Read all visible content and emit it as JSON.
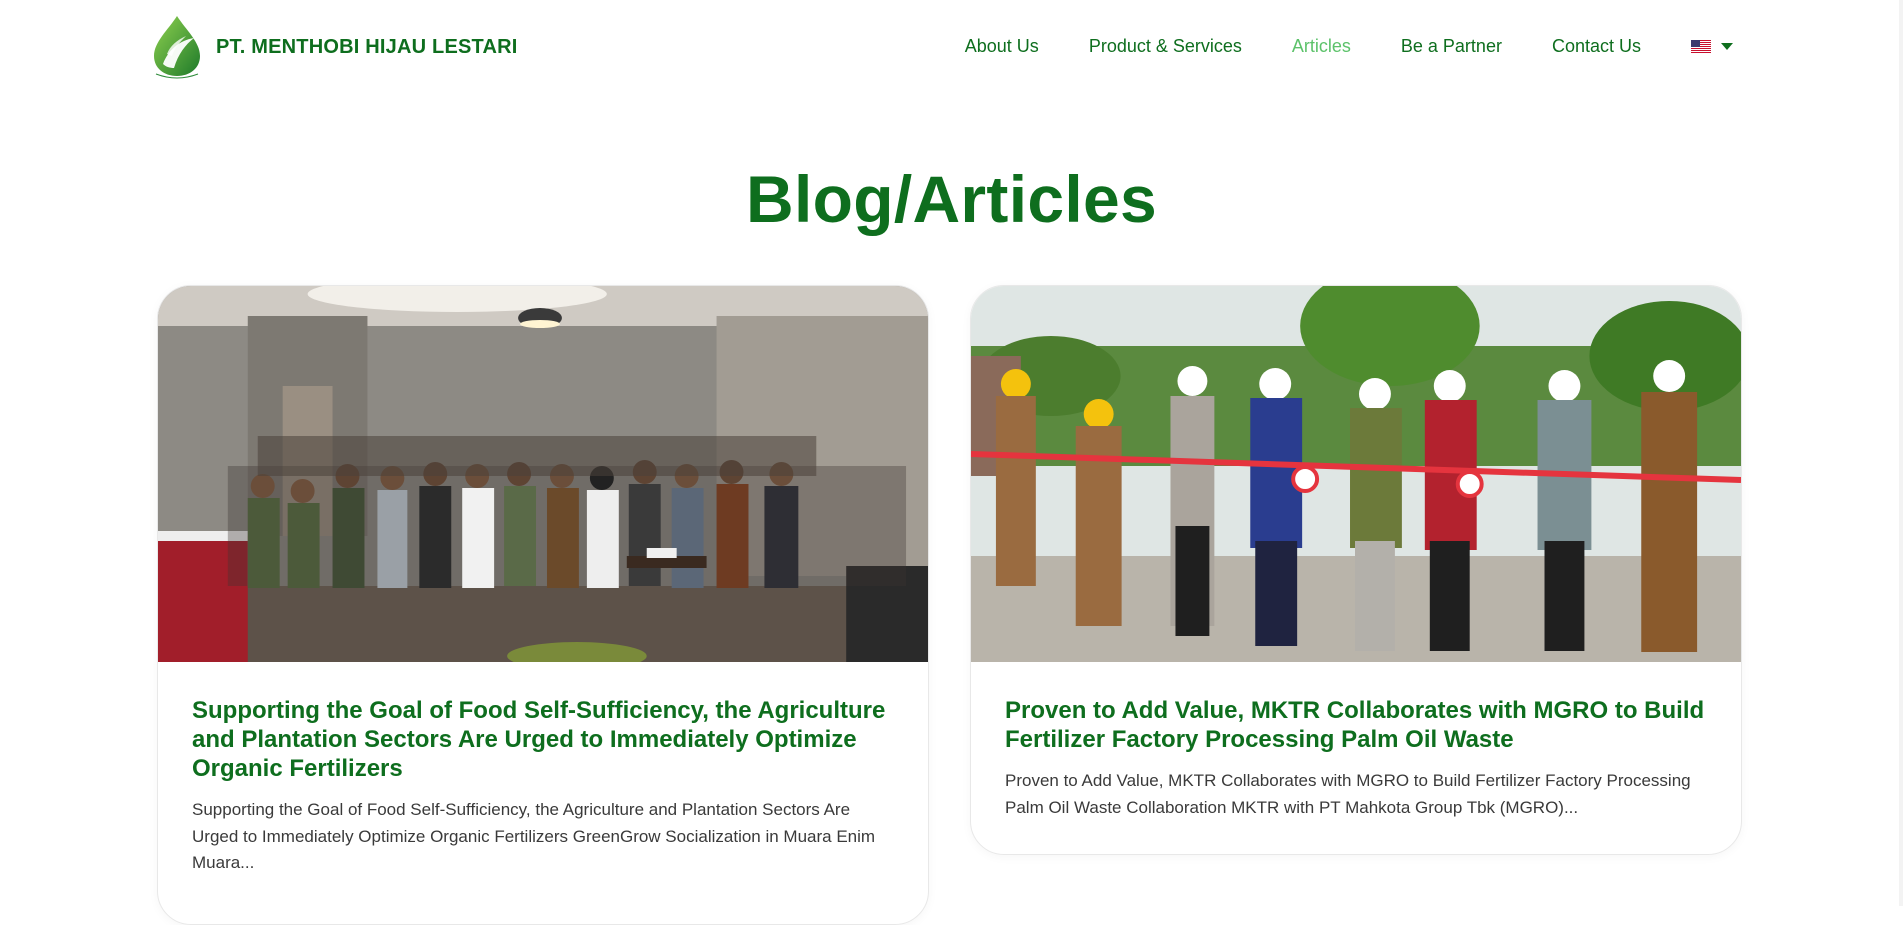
{
  "brand": {
    "name": "PT. MENTHOBI HIJAU LESTARI",
    "logo_icon": "leaf-drop-logo-icon",
    "color": "#0e6e1e"
  },
  "nav": {
    "items": [
      {
        "label": "About Us",
        "active": false
      },
      {
        "label": "Product & Services",
        "active": false
      },
      {
        "label": "Articles",
        "active": true
      },
      {
        "label": "Be a Partner",
        "active": false
      },
      {
        "label": "Contact Us",
        "active": false
      }
    ],
    "language_icon": "us-flag-icon",
    "active_color": "#5cc26a"
  },
  "page": {
    "title": "Blog/Articles"
  },
  "articles": [
    {
      "image_icon": "group-meeting-photo",
      "title": "Supporting the Goal of Food Self-Sufficiency, the Agriculture and Plantation Sectors Are Urged to Immediately Optimize Organic Fertilizers",
      "excerpt": "Supporting the Goal of Food Self-Sufficiency, the Agriculture and Plantation Sectors Are Urged to Immediately Optimize Organic Fertilizers GreenGrow Socialization in Muara Enim Muara..."
    },
    {
      "image_icon": "ribbon-cutting-photo",
      "title": "Proven to Add Value, MKTR Collaborates with MGRO to Build Fertilizer Factory Processing Palm Oil Waste",
      "excerpt": "Proven to Add Value, MKTR Collaborates with MGRO to Build Fertilizer Factory Processing Palm Oil Waste Collaboration MKTR with PT Mahkota Group Tbk (MGRO)..."
    }
  ]
}
